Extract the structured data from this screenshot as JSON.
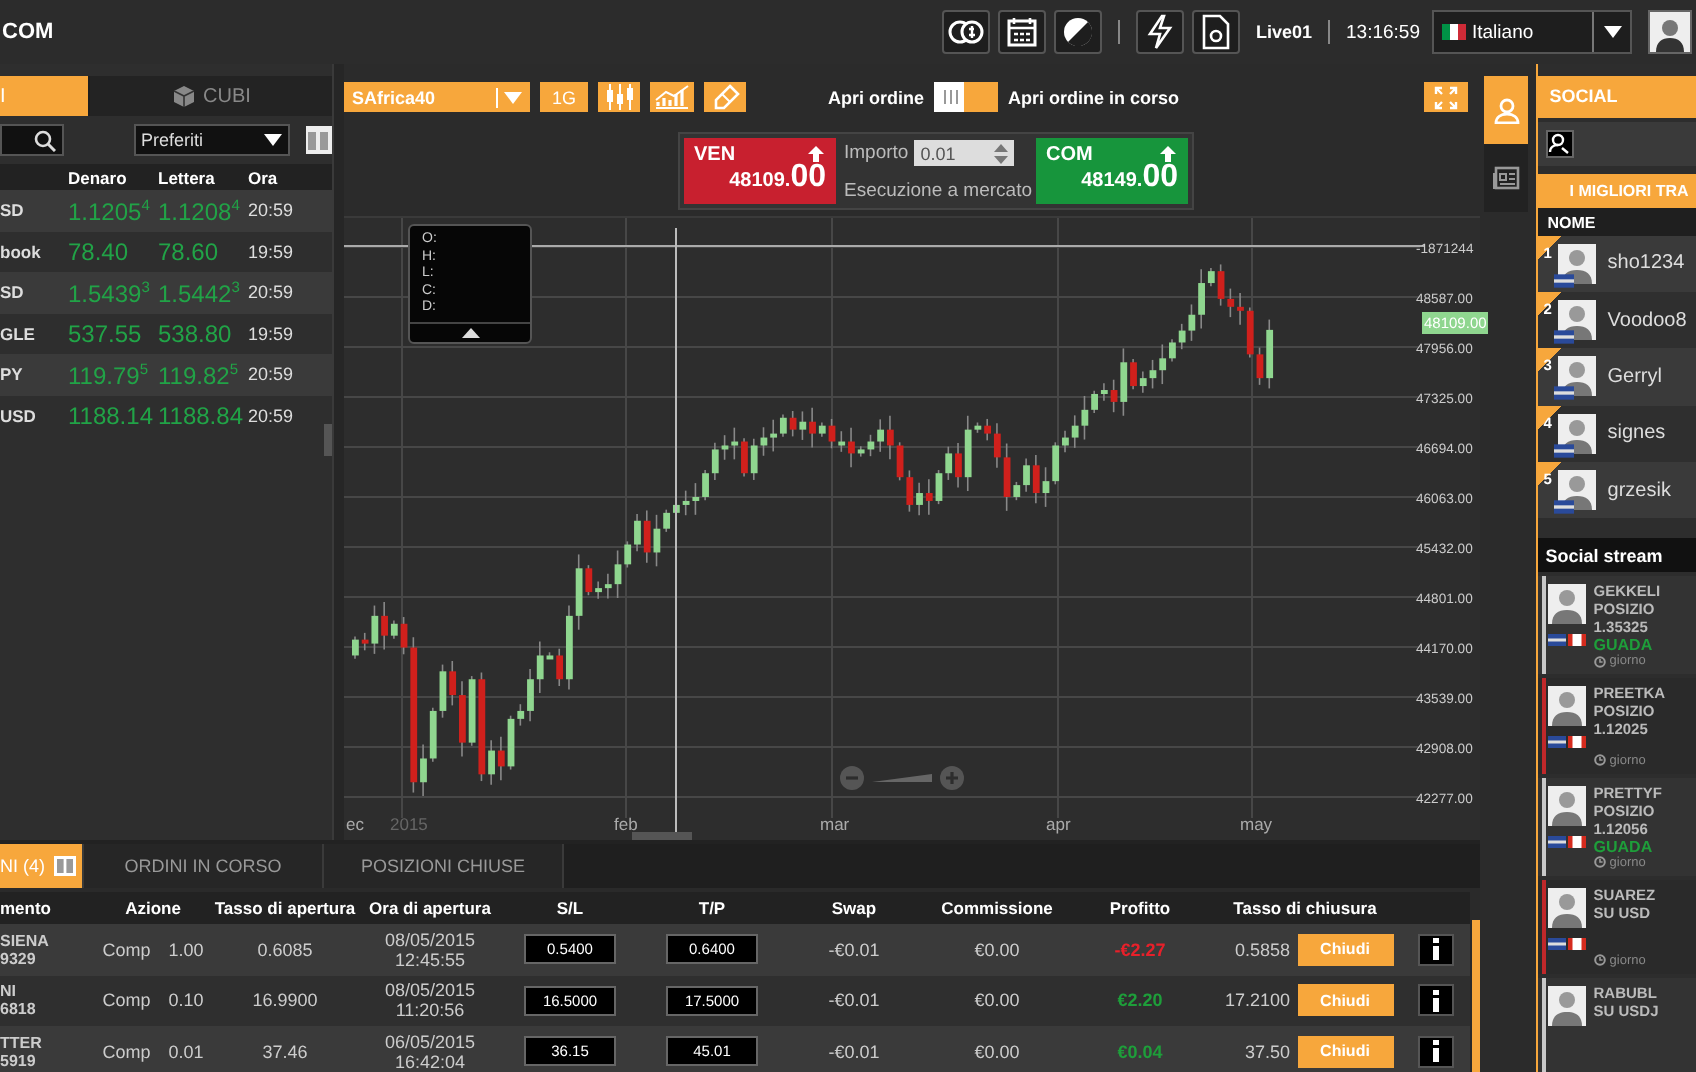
{
  "brand": "COM",
  "account": "Live01",
  "time": "13:16:59",
  "language": {
    "label": "Italiano"
  },
  "left_panel": {
    "tabs": [
      {
        "label": "I",
        "selected": true
      },
      {
        "label": "CUBI",
        "selected": false
      }
    ],
    "filter": "Preferiti",
    "columns": [
      "Denaro",
      "Lettera",
      "Ora"
    ],
    "rows": [
      {
        "name": "SD",
        "bid": "1.1205$^{4}$",
        "ask": "1.1208$^{4}$",
        "time": "20:59"
      },
      {
        "name": "book",
        "bid": "78.40",
        "ask": "78.60",
        "time": "19:59"
      },
      {
        "name": "SD",
        "bid": "1.5439$^{3}$",
        "ask": "1.5442$^{3}$",
        "time": "20:59"
      },
      {
        "name": "GLE",
        "bid": "537.55",
        "ask": "538.80",
        "time": "19:59"
      },
      {
        "name": "PY",
        "bid": "119.79$^{5}$",
        "ask": "119.82$^{5}$",
        "time": "20:59"
      },
      {
        "name": "USD",
        "bid": "1188.14",
        "ask": "1188.84",
        "time": "20:59"
      }
    ]
  },
  "chart_toolbar": {
    "symbol": "SAfrica40",
    "period": "1G",
    "open_order_label": "Apri ordine",
    "toggle_on": false,
    "pending_label": "Apri ordine in corso"
  },
  "order": {
    "sell": {
      "label": "VEN",
      "price_main": "48109.",
      "price_pips": "00"
    },
    "amount_label": "Importo",
    "amount": "0.01",
    "execution": "Esecuzione a mercato",
    "buy": {
      "label": "COM",
      "price_main": "48149.",
      "price_pips": "00"
    }
  },
  "chart": {
    "ohlc_labels": [
      "O:",
      "H:",
      "L:",
      "C:",
      "D:"
    ],
    "price_tag": "48109.00",
    "zoom": {
      "level": 1
    },
    "y_labels": [
      "-1871244",
      "48587.00",
      "47956.00",
      "47325.00",
      "46694.00",
      "46063.00",
      "45432.00",
      "44801.00",
      "44170.00",
      "43539.00",
      "42908.00",
      "42277.00"
    ],
    "x_labels": [
      "ec",
      "2015",
      "feb",
      "mar",
      "apr",
      "may"
    ]
  },
  "bottom": {
    "tabs": [
      {
        "label": "NI (4)",
        "selected": true
      },
      {
        "label": "ORDINI IN CORSO",
        "selected": false
      },
      {
        "label": "POSIZIONI CHIUSE",
        "selected": false
      }
    ],
    "columns": [
      "mento",
      "Azione",
      "Tasso di apertura",
      "Ora di apertura",
      "S/L",
      "T/P",
      "Swap",
      "Commissione",
      "Profitto",
      "Tasso di chiusura"
    ],
    "rows": [
      {
        "name": "SIENA",
        "code": "9329",
        "action": "Comp",
        "qty": "1.00",
        "open_rate": "0.6085",
        "open_date": "08/05/2015",
        "open_time": "12:45:55",
        "sl": "0.5400",
        "tp": "0.6400",
        "swap": "-€0.01",
        "commission": "€0.00",
        "profit": "-€2.27",
        "color": "#e8202a",
        "close_rate": "0.5858",
        "close_label": "Chiudi"
      },
      {
        "name": "NI",
        "code": "6818",
        "action": "Comp",
        "qty": "0.10",
        "open_rate": "16.9900",
        "open_date": "08/05/2015",
        "open_time": "11:20:56",
        "sl": "16.5000",
        "tp": "17.5000",
        "swap": "-€0.01",
        "commission": "€0.00",
        "profit": "€2.20",
        "color": "#1e9e3a",
        "close_rate": "17.2100",
        "close_label": "Chiudi"
      },
      {
        "name": "TTER",
        "code": "5919",
        "action": "Comp",
        "qty": "0.01",
        "open_rate": "37.46",
        "open_date": "06/05/2015",
        "open_time": "16:42:04",
        "sl": "36.15",
        "tp": "45.01",
        "swap": "-€0.01",
        "commission": "€0.00",
        "profit": "€0.04",
        "color": "#1e9e3a",
        "close_rate": "37.50",
        "close_label": "Chiudi"
      }
    ]
  },
  "social": {
    "side_tabs": [
      {
        "kind": "people",
        "selected": true
      },
      {
        "kind": "news",
        "selected": false
      }
    ],
    "title": "SOCIAL",
    "top_title": "I MIGLIORI TRA",
    "name_header": "NOME",
    "traders": [
      {
        "rank": "1",
        "name": "sho1234"
      },
      {
        "rank": "2",
        "name": "Voodoo8"
      },
      {
        "rank": "3",
        "name": "Gerryl"
      },
      {
        "rank": "4",
        "name": "signes"
      },
      {
        "rank": "5",
        "name": "grzesik"
      }
    ],
    "stream_title": "Social stream",
    "stream": [
      {
        "color": "#c8c8c8",
        "lines": [
          "GEKKELI",
          "POSIZIO",
          "1.35325"
        ],
        "result": "GUADA",
        "time": "giorno"
      },
      {
        "color": "#c0282a",
        "lines": [
          "PREETKA",
          "POSIZIO",
          "1.12025"
        ],
        "time": "giorno"
      },
      {
        "color": "#c8c8c8",
        "lines": [
          "PRETTYF",
          "POSIZIO",
          "1.12056"
        ],
        "result": "GUADA",
        "time": "giorno"
      },
      {
        "color": "#c0282a",
        "lines": [
          "SUAREZ",
          "SU USD"
        ],
        "time": "giorno"
      },
      {
        "color": "#c8c8c8",
        "lines": [
          "RABUBL",
          "SU USDJ"
        ]
      }
    ]
  }
}
